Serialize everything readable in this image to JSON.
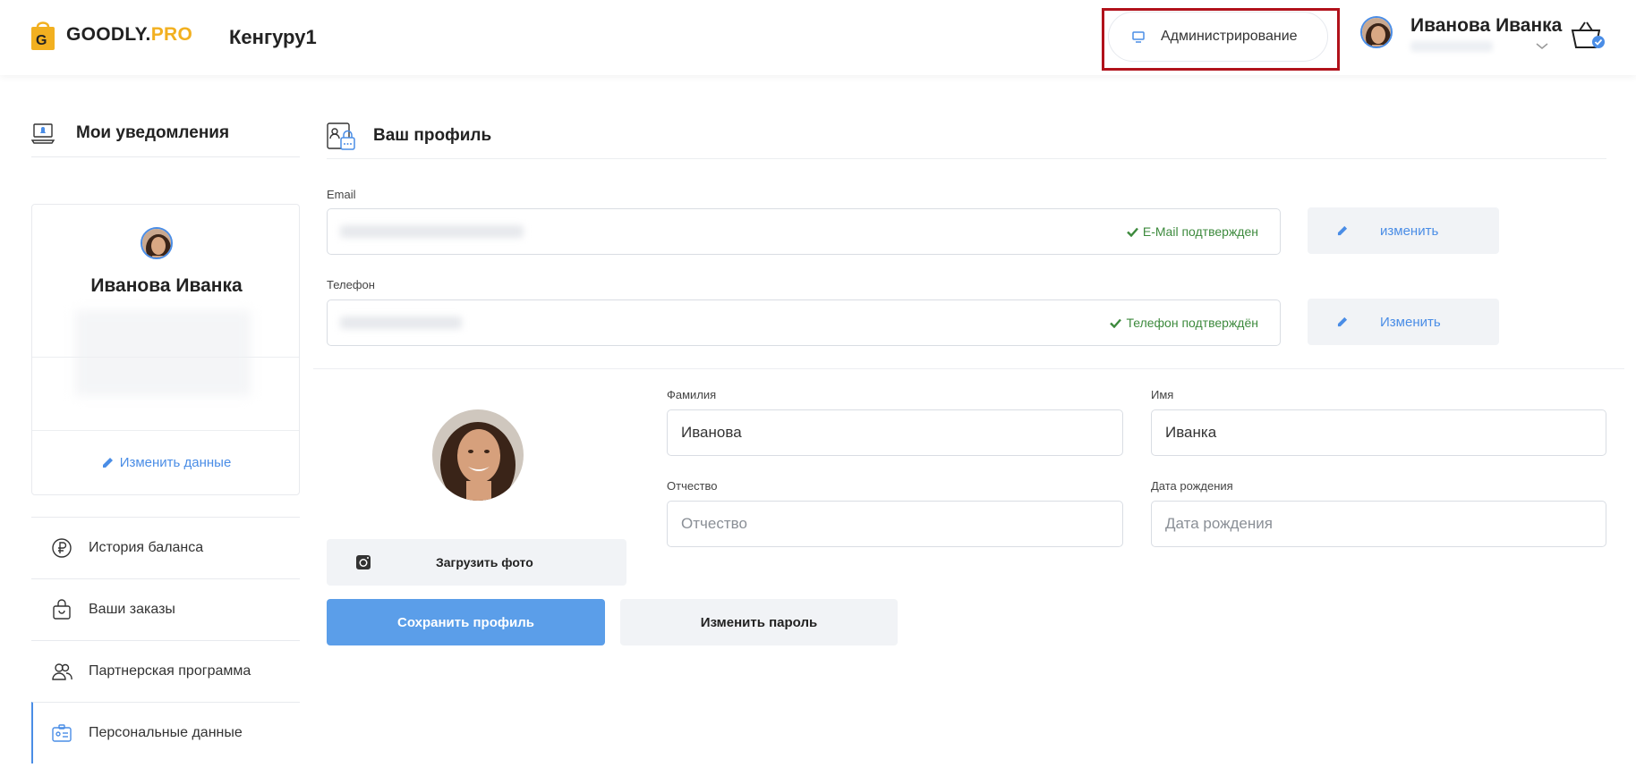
{
  "header": {
    "brand_main": "GOODLY.",
    "brand_accent": "PRO",
    "shop_name": "Кенгуру1",
    "admin_label": "Администрирование",
    "user_name": "Иванова Иванка"
  },
  "sidebar": {
    "title": "Мои уведомления",
    "profile_name": "Иванова Иванка",
    "edit_label": "Изменить данные",
    "items": [
      {
        "label": "История баланса",
        "icon": "ruble-icon"
      },
      {
        "label": "Ваши заказы",
        "icon": "bag-icon"
      },
      {
        "label": "Партнерская программа",
        "icon": "users-icon"
      },
      {
        "label": "Персональные данные",
        "icon": "id-card-icon",
        "active": true
      }
    ]
  },
  "main": {
    "title": "Ваш профиль",
    "email_label": "Email",
    "email_status": "E-Mail подтвержден",
    "email_change": "изменить",
    "phone_label": "Телефон",
    "phone_status": "Телефон подтверждён",
    "phone_change": "Изменить",
    "upload_label": "Загрузить фото",
    "lastname_label": "Фамилия",
    "lastname_value": "Иванова",
    "firstname_label": "Имя",
    "firstname_value": "Иванка",
    "patronymic_label": "Отчество",
    "patronymic_placeholder": "Отчество",
    "birthdate_label": "Дата рождения",
    "birthdate_placeholder": "Дата рождения",
    "save_label": "Сохранить профиль",
    "password_label": "Изменить пароль"
  },
  "colors": {
    "accent": "#4a8de6",
    "brand_yellow": "#f2b020",
    "verified": "#3d8a3d",
    "highlight": "#b1121b"
  }
}
